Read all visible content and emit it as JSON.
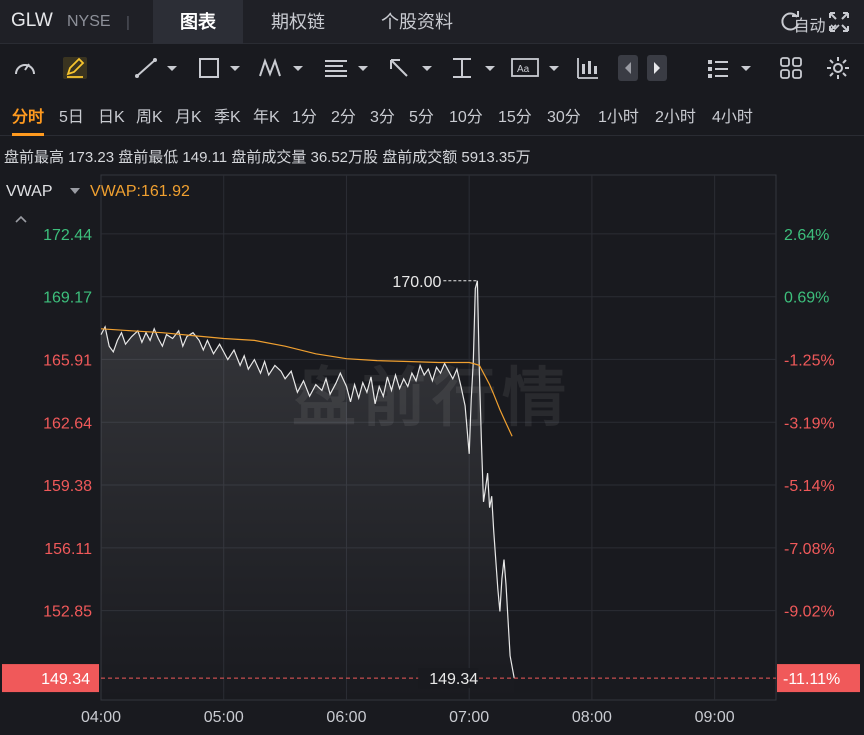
{
  "header": {
    "symbol": "GLW",
    "exchange": "NYSE",
    "separator": "|",
    "tabs": [
      "图表",
      "期权链",
      "个股资料"
    ],
    "active_tab": 0
  },
  "toolbar_icons": [
    "gauge-icon",
    "pencil-icon",
    "line-tool-icon",
    "rectangle-tool-icon",
    "pattern-tool-icon",
    "fib-tool-icon",
    "arrow-tool-icon",
    "measure-tool-icon",
    "text-tool-icon",
    "indicator-icon",
    "prev-icon",
    "next-icon",
    "layout-list-icon",
    "grid-icon",
    "settings-icon"
  ],
  "periods": [
    "分时",
    "5日",
    "日K",
    "周K",
    "月K",
    "季K",
    "年K",
    "1分",
    "2分",
    "3分",
    "5分",
    "10分",
    "15分",
    "30分",
    "1小时",
    "2小时",
    "4小时"
  ],
  "active_period": 0,
  "auto_label": "自动",
  "stats": "盘前最高 173.23 盘前最低 149.11 盘前成交量 36.52万股 盘前成交额 5913.35万",
  "indicator": {
    "name": "VWAP",
    "value_label": "VWAP:161.92"
  },
  "watermark": "盘前行情",
  "colors": {
    "up": "#3dbf7c",
    "down": "#f0595a",
    "vwap": "#f0a030",
    "price": "#e8e8e8",
    "badge": "#f0595a"
  },
  "chart_data": {
    "type": "line",
    "ylim": [
      148.2,
      175.5
    ],
    "xlim": [
      "04:00",
      "09:30"
    ],
    "x_ticks": [
      "04:00",
      "05:00",
      "06:00",
      "07:00",
      "08:00",
      "09:00"
    ],
    "y_ticks_left": [
      "172.44",
      "169.17",
      "165.91",
      "162.64",
      "159.38",
      "156.11",
      "152.85"
    ],
    "y_ticks_right": [
      "2.64%",
      "0.69%",
      "-1.25%",
      "-3.19%",
      "-5.14%",
      "-7.08%",
      "-9.02%"
    ],
    "y_tick_values": [
      172.44,
      169.17,
      165.91,
      162.64,
      159.38,
      156.11,
      152.85
    ],
    "y_tick_up": [
      true,
      true,
      false,
      false,
      false,
      false,
      false
    ],
    "current": {
      "price_label": "149.34",
      "pct_label": "-11.11%",
      "value": 149.34
    },
    "annotations": [
      {
        "label": "170.00",
        "time": "07:04",
        "value": 170.0
      },
      {
        "label": "149.34",
        "time": "07:22",
        "value": 149.34
      }
    ],
    "series": [
      {
        "name": "Price",
        "points": [
          [
            "04:00",
            167.2
          ],
          [
            "04:02",
            167.6
          ],
          [
            "04:04",
            166.6
          ],
          [
            "04:06",
            166.3
          ],
          [
            "04:08",
            166.9
          ],
          [
            "04:10",
            167.3
          ],
          [
            "04:12",
            166.7
          ],
          [
            "04:15",
            167.1
          ],
          [
            "04:18",
            167.4
          ],
          [
            "04:20",
            166.8
          ],
          [
            "04:22",
            167.3
          ],
          [
            "04:24",
            166.9
          ],
          [
            "04:26",
            167.5
          ],
          [
            "04:28",
            167.0
          ],
          [
            "04:30",
            166.6
          ],
          [
            "04:32",
            167.2
          ],
          [
            "04:35",
            167.0
          ],
          [
            "04:38",
            167.4
          ],
          [
            "04:40",
            166.6
          ],
          [
            "04:42",
            167.1
          ],
          [
            "04:45",
            167.3
          ],
          [
            "04:48",
            166.9
          ],
          [
            "04:50",
            166.4
          ],
          [
            "04:52",
            166.9
          ],
          [
            "04:55",
            166.2
          ],
          [
            "04:58",
            166.7
          ],
          [
            "05:00",
            166.3
          ],
          [
            "05:02",
            165.9
          ],
          [
            "05:05",
            166.4
          ],
          [
            "05:08",
            165.6
          ],
          [
            "05:10",
            166.1
          ],
          [
            "05:12",
            165.4
          ],
          [
            "05:15",
            165.9
          ],
          [
            "05:18",
            165.2
          ],
          [
            "05:20",
            165.8
          ],
          [
            "05:22",
            165.1
          ],
          [
            "05:25",
            165.6
          ],
          [
            "05:28",
            165.3
          ],
          [
            "05:30",
            164.9
          ],
          [
            "05:33",
            165.3
          ],
          [
            "05:36",
            164.2
          ],
          [
            "05:39",
            164.8
          ],
          [
            "05:42",
            164.0
          ],
          [
            "05:45",
            164.6
          ],
          [
            "05:48",
            164.3
          ],
          [
            "05:50",
            164.9
          ],
          [
            "05:52",
            164.1
          ],
          [
            "05:55",
            164.7
          ],
          [
            "05:57",
            165.2
          ],
          [
            "06:00",
            164.5
          ],
          [
            "06:02",
            163.7
          ],
          [
            "06:04",
            164.6
          ],
          [
            "06:06",
            163.9
          ],
          [
            "06:08",
            164.7
          ],
          [
            "06:10",
            164.2
          ],
          [
            "06:12",
            165.0
          ],
          [
            "06:14",
            163.6
          ],
          [
            "06:16",
            164.5
          ],
          [
            "06:18",
            164.0
          ],
          [
            "06:20",
            165.0
          ],
          [
            "06:22",
            164.3
          ],
          [
            "06:24",
            165.1
          ],
          [
            "06:26",
            164.4
          ],
          [
            "06:28",
            164.9
          ],
          [
            "06:30",
            164.5
          ],
          [
            "06:32",
            165.2
          ],
          [
            "06:34",
            164.8
          ],
          [
            "06:36",
            165.6
          ],
          [
            "06:38",
            165.1
          ],
          [
            "06:40",
            165.4
          ],
          [
            "06:42",
            164.8
          ],
          [
            "06:44",
            165.5
          ],
          [
            "06:46",
            165.2
          ],
          [
            "06:48",
            165.7
          ],
          [
            "06:50",
            165.3
          ],
          [
            "06:52",
            164.9
          ],
          [
            "06:54",
            165.4
          ],
          [
            "06:56",
            164.5
          ],
          [
            "06:58",
            163.5
          ],
          [
            "07:00",
            161.0
          ],
          [
            "07:01",
            163.8
          ],
          [
            "07:02",
            165.8
          ],
          [
            "07:03",
            169.6
          ],
          [
            "07:04",
            170.0
          ],
          [
            "07:05",
            165.2
          ],
          [
            "07:06",
            161.5
          ],
          [
            "07:07",
            158.5
          ],
          [
            "07:08",
            159.2
          ],
          [
            "07:09",
            160.0
          ],
          [
            "07:10",
            158.2
          ],
          [
            "07:11",
            158.8
          ],
          [
            "07:12",
            157.0
          ],
          [
            "07:14",
            154.0
          ],
          [
            "07:15",
            152.8
          ],
          [
            "07:16",
            154.5
          ],
          [
            "07:17",
            155.5
          ],
          [
            "07:18",
            154.2
          ],
          [
            "07:20",
            150.5
          ],
          [
            "07:22",
            149.34
          ]
        ]
      },
      {
        "name": "VWAP",
        "points": [
          [
            "04:00",
            167.5
          ],
          [
            "04:15",
            167.4
          ],
          [
            "04:30",
            167.3
          ],
          [
            "04:45",
            167.15
          ],
          [
            "05:00",
            167.0
          ],
          [
            "05:15",
            166.9
          ],
          [
            "05:30",
            166.6
          ],
          [
            "05:45",
            166.2
          ],
          [
            "06:00",
            165.95
          ],
          [
            "06:15",
            165.85
          ],
          [
            "06:30",
            165.8
          ],
          [
            "06:45",
            165.75
          ],
          [
            "07:00",
            165.75
          ],
          [
            "07:02",
            165.7
          ],
          [
            "07:05",
            165.6
          ],
          [
            "07:08",
            165.0
          ],
          [
            "07:10",
            164.6
          ],
          [
            "07:12",
            164.1
          ],
          [
            "07:15",
            163.3
          ],
          [
            "07:18",
            162.6
          ],
          [
            "07:21",
            161.92
          ]
        ]
      }
    ]
  }
}
